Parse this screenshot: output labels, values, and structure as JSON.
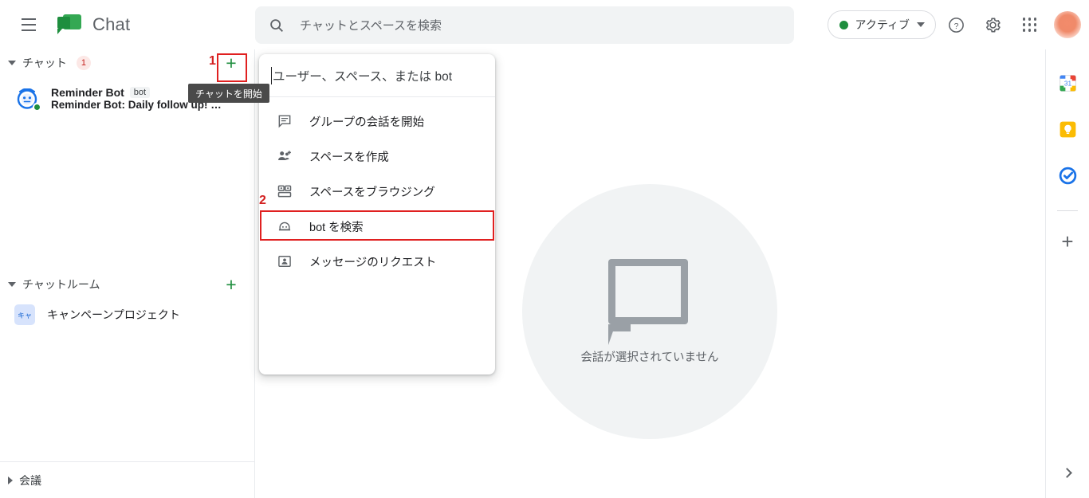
{
  "header": {
    "menu_icon": "hamburger-icon",
    "brand": "Chat",
    "search_placeholder": "チャットとスペースを検索",
    "search_icon": "search-icon",
    "status_label": "アクティブ",
    "status_color": "#1e8e3e",
    "help_icon": "help-icon",
    "settings_icon": "gear-icon",
    "apps_icon": "apps-grid-icon",
    "avatar_icon": "account-avatar"
  },
  "sidebar": {
    "chat_section": {
      "title": "チャット",
      "badge": "1",
      "add_label": "+"
    },
    "conversations": [
      {
        "name": "Reminder Bot",
        "tag": "bot",
        "snippet": "Reminder Bot: Daily follow up! …",
        "avatar_icon": "alarm-clock-avatar",
        "presence": "active"
      }
    ],
    "rooms_section": {
      "title": "チャットルーム",
      "add_label": "+"
    },
    "rooms": [
      {
        "name": "キャンペーンプロジェクト",
        "chip": "キャ"
      }
    ],
    "meet_section": {
      "title": "会議"
    }
  },
  "tooltip": {
    "text": "チャットを開始"
  },
  "annotations": {
    "step1": "1",
    "step2": "2",
    "highlight_color": "#e02020"
  },
  "dropdown": {
    "input_placeholder": "ユーザー、スペース、または  bot",
    "items": [
      {
        "label": "グループの会話を開始",
        "icon": "chat-lines-icon"
      },
      {
        "label": "スペースを作成",
        "icon": "people-add-icon"
      },
      {
        "label": "スペースをブラウジング",
        "icon": "browse-spaces-icon"
      },
      {
        "label": "bot を検索",
        "icon": "robot-icon"
      },
      {
        "label": "メッセージのリクエスト",
        "icon": "person-card-icon"
      }
    ]
  },
  "main": {
    "empty_text": "会話が選択されていません",
    "empty_icon": "chat-bubble-icon"
  },
  "rail": {
    "items": [
      {
        "name": "calendar-icon",
        "label": "31"
      },
      {
        "name": "keep-icon",
        "label": ""
      },
      {
        "name": "tasks-icon",
        "label": ""
      }
    ],
    "add_label": "+",
    "expand_icon": "chevron-right-icon"
  }
}
